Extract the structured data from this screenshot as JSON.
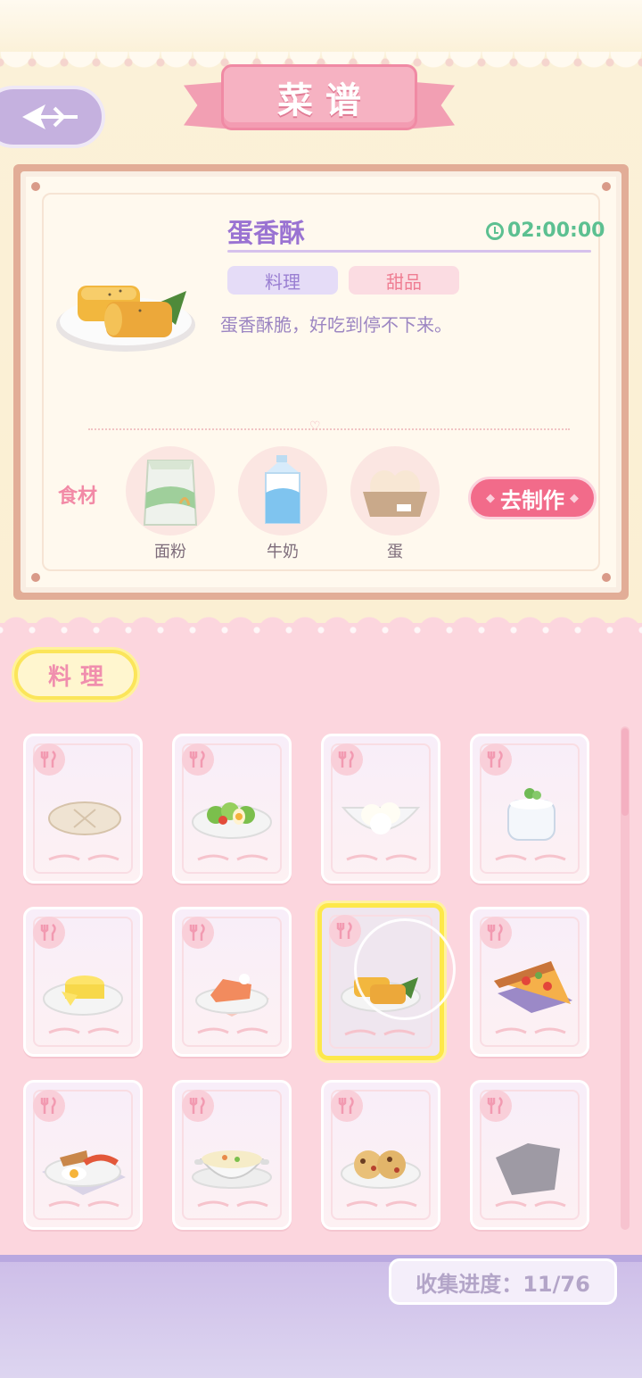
{
  "header": {
    "title": "菜谱"
  },
  "recipe": {
    "name": "蛋香酥",
    "timer": "02:00:00",
    "tags": [
      "料理",
      "甜品"
    ],
    "description": "蛋香酥脆，好吃到停不下来。",
    "ingredients_label": "食材",
    "ingredients": [
      {
        "name": "面粉",
        "icon": "flour-bag-icon"
      },
      {
        "name": "牛奶",
        "icon": "milk-carton-icon"
      },
      {
        "name": "蛋",
        "icon": "eggs-icon"
      }
    ],
    "make_button": "去制作"
  },
  "category_tab": "料理",
  "collection": {
    "progress_text": "收集进度：11/76",
    "collected": 11,
    "total": 76
  },
  "grid_items": [
    {
      "icon": "flatbread-icon"
    },
    {
      "icon": "egg-salad-icon"
    },
    {
      "icon": "rice-ball-icon"
    },
    {
      "icon": "yogurt-jar-icon"
    },
    {
      "icon": "cheese-omelette-icon"
    },
    {
      "icon": "salmon-cake-icon"
    },
    {
      "icon": "egg-pastry-icon",
      "selected": true
    },
    {
      "icon": "pizza-slice-icon"
    },
    {
      "icon": "breakfast-plate-icon"
    },
    {
      "icon": "soup-bowl-icon"
    },
    {
      "icon": "cookies-icon"
    },
    {
      "icon": "locked-silhouette-icon"
    }
  ],
  "colors": {
    "accent_pink": "#f26b8a",
    "purple_text": "#9a73d2",
    "timer_green": "#5cc091",
    "highlight_yellow": "#fde84a"
  }
}
